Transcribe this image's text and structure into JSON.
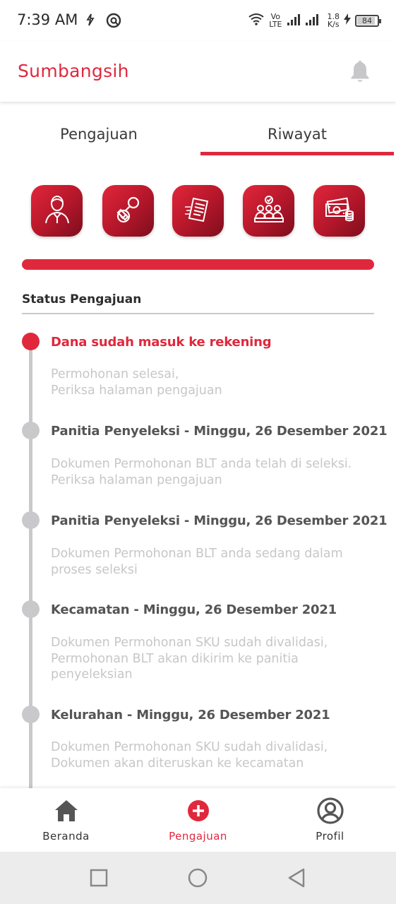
{
  "status_bar": {
    "time": "7:39 AM",
    "network_speed_top": "1.8",
    "network_speed_bottom": "K/s",
    "volte_top": "Vo",
    "volte_bottom": "LTE",
    "battery": "84",
    "icons": [
      "sync-icon",
      "vpn-icon",
      "wifi-icon",
      "signal-icon",
      "charging-icon",
      "battery-icon"
    ]
  },
  "header": {
    "title": "Sumbangsih",
    "notification_icon": "bell-icon"
  },
  "tabs": [
    {
      "label": "Pengajuan",
      "active": false
    },
    {
      "label": "Riwayat",
      "active": true
    }
  ],
  "steps": [
    {
      "icon": "person-icon"
    },
    {
      "icon": "stamp-icon"
    },
    {
      "icon": "document-icon"
    },
    {
      "icon": "committee-icon"
    },
    {
      "icon": "money-icon"
    }
  ],
  "progress_fraction": 1.0,
  "section": {
    "title": "Status Pengajuan"
  },
  "timeline": [
    {
      "title": "Dana sudah masuk ke rekening",
      "description": "Permohonan selesai,\nPeriksa halaman pengajuan",
      "active": true
    },
    {
      "title": "Panitia Penyeleksi - Minggu, 26 Desember 2021",
      "description": "Dokumen Permohonan BLT anda telah di seleksi.\nPeriksa halaman pengajuan",
      "active": false
    },
    {
      "title": "Panitia Penyeleksi - Minggu, 26 Desember 2021",
      "description": "Dokumen Permohonan BLT anda sedang dalam proses seleksi",
      "active": false
    },
    {
      "title": "Kecamatan - Minggu, 26 Desember 2021",
      "description": "Dokumen Permohonan SKU sudah divalidasi, Permohonan BLT akan dikirim ke panitia penyeleksian",
      "active": false
    },
    {
      "title": "Kelurahan - Minggu, 26 Desember 2021",
      "description": "Dokumen Permohonan SKU sudah divalidasi, Dokumen akan diteruskan ke kecamatan",
      "active": false
    }
  ],
  "bottom_nav": [
    {
      "label": "Beranda",
      "icon": "home-icon",
      "active": false
    },
    {
      "label": "Pengajuan",
      "icon": "plus-circle-icon",
      "active": true
    },
    {
      "label": "Profil",
      "icon": "profile-icon",
      "active": false
    }
  ],
  "system_nav": [
    "recents-button",
    "home-button",
    "back-button"
  ],
  "colors": {
    "accent": "#e0283d",
    "inactive_dot": "#c9c9cc",
    "desc_text": "#c7c7c9"
  }
}
